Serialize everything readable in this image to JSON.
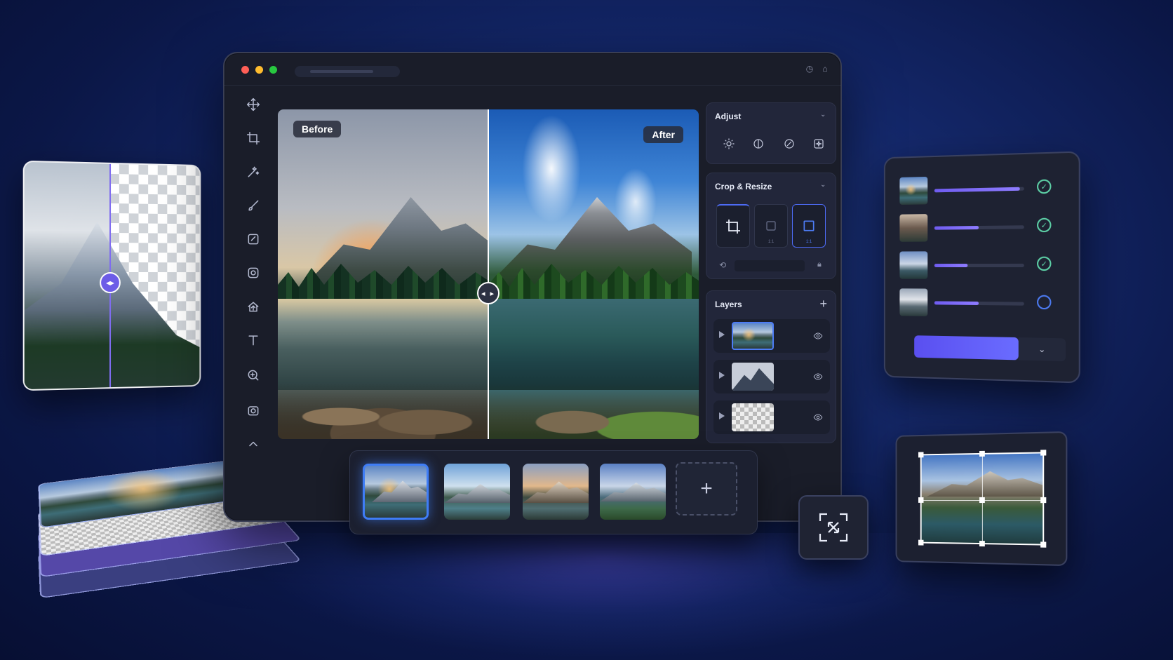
{
  "colors": {
    "accent": "#6c5ce7",
    "highlight_blue": "#3f7df6",
    "panel_bg": "#22263a",
    "window_bg": "#1a1d29",
    "success": "#5ed3a8"
  },
  "window": {
    "traffic_lights": [
      "#ff5f57",
      "#febc2e",
      "#28c840"
    ],
    "titlebar_icons": [
      "clock-icon",
      "home-icon"
    ]
  },
  "toolbar": {
    "tools": [
      {
        "name": "move-tool",
        "icon": "move-icon"
      },
      {
        "name": "crop-tool",
        "icon": "crop-icon"
      },
      {
        "name": "magic-tool",
        "icon": "magic-wand-icon"
      },
      {
        "name": "brush-tool",
        "icon": "brush-icon"
      },
      {
        "name": "retouch-tool",
        "icon": "retouch-icon"
      },
      {
        "name": "mask-tool",
        "icon": "mask-icon"
      },
      {
        "name": "export-tool",
        "icon": "upload-icon"
      },
      {
        "name": "text-tool",
        "icon": "text-icon"
      },
      {
        "name": "zoom-tool",
        "icon": "zoom-icon"
      },
      {
        "name": "camera-tool",
        "icon": "camera-icon"
      },
      {
        "name": "collapse-tool",
        "icon": "chevron-up-icon"
      }
    ]
  },
  "canvas": {
    "before_label": "Before",
    "after_label": "After",
    "compare_handle_glyph": "◂ ▸"
  },
  "panels": {
    "adjust": {
      "title": "Adjust",
      "icons": [
        "brightness-icon",
        "contrast-icon",
        "auto-enhance-icon",
        "sparkle-icon"
      ]
    },
    "crop": {
      "title": "Crop & Resize",
      "presets": [
        {
          "icon": "crop-icon",
          "label": ""
        },
        {
          "icon": "square-icon",
          "label": "1:1"
        },
        {
          "icon": "frame-icon",
          "label": "1:1"
        }
      ],
      "selected_preset": 2
    },
    "layers": {
      "title": "Layers",
      "add_glyph": "+",
      "items": [
        {
          "kind": "photo",
          "selected": true
        },
        {
          "kind": "mountain-silhouette",
          "selected": false
        },
        {
          "kind": "transparent",
          "selected": false
        }
      ]
    }
  },
  "filmstrip": {
    "selected_index": 0,
    "add_glyph": "+",
    "thumb_count": 4
  },
  "batch": {
    "items": [
      {
        "progress": 0.95,
        "status": "done"
      },
      {
        "progress": 0.5,
        "status": "done"
      },
      {
        "progress": 0.38,
        "status": "done"
      },
      {
        "progress": 0.5,
        "status": "pending"
      }
    ],
    "dropdown_glyph": "⌄"
  },
  "bg_remover": {
    "handle_glyph": "◂▸"
  }
}
